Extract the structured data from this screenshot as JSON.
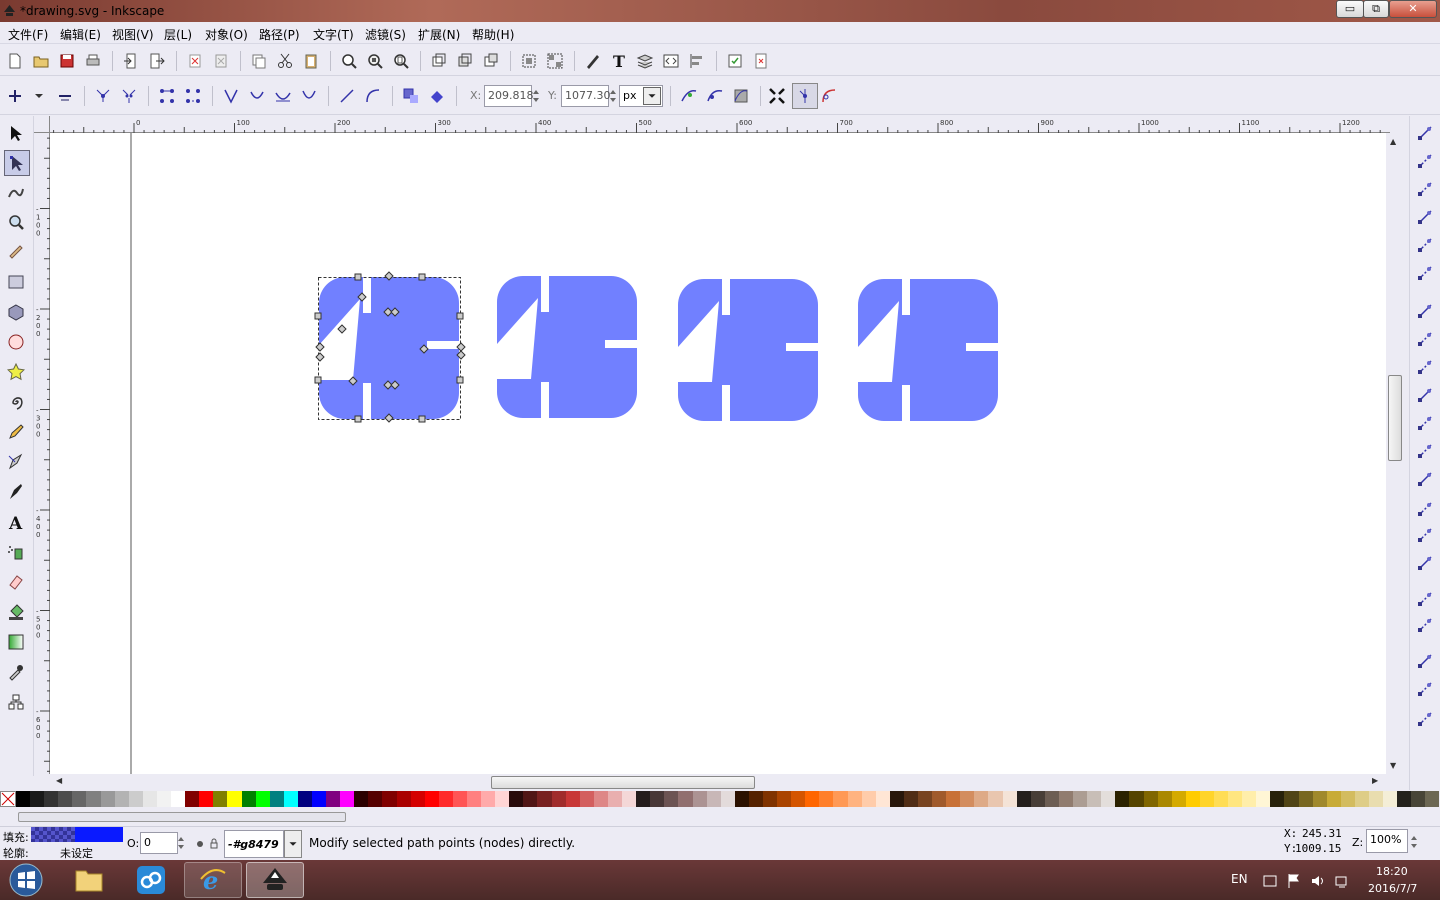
{
  "window": {
    "title": "*drawing.svg - Inkscape",
    "min_label": "▭",
    "max_label": "⧉",
    "close_label": "✕"
  },
  "menu": [
    "文件(F)",
    "编辑(E)",
    "视图(V)",
    "层(L)",
    "对象(O)",
    "路径(P)",
    "文字(T)",
    "滤镜(S)",
    "扩展(N)",
    "帮助(H)"
  ],
  "node_toolbar": {
    "x_label": "X:",
    "x_value": "209.818",
    "y_label": "Y:",
    "y_value": "1077.30",
    "unit": "px"
  },
  "ruler": {
    "h_ticks": [
      "0",
      "100",
      "200",
      "300",
      "400",
      "500",
      "600",
      "700",
      "800",
      "900",
      "1000",
      "1100",
      "1200"
    ],
    "v_ticks": [
      "-100",
      "-200",
      "-300",
      "-400",
      "-500",
      "-600",
      "-700",
      "-800"
    ]
  },
  "shapes": {
    "fill_color": "#7180ff",
    "count": 4
  },
  "status": {
    "fill_label": "填充:",
    "stroke_label": "轮廓:",
    "stroke_value": "未设定",
    "opacity_label": "O:",
    "opacity_value": "0",
    "layer_value": "-#g8479",
    "message": "Modify selected path points (nodes) directly.",
    "cursor_x_label": "X:",
    "cursor_x": "245.31",
    "cursor_y_label": "Y:",
    "cursor_y": "1009.15",
    "zoom_label": "Z:",
    "zoom_value": "100%"
  },
  "taskbar": {
    "lang": "EN",
    "time": "18:20",
    "date": "2016/7/7"
  },
  "colors": {
    "fill_swatch": "#0a1aff",
    "palette": [
      "#000000",
      "#1a1a1a",
      "#333333",
      "#4d4d4d",
      "#666666",
      "#808080",
      "#999999",
      "#b3b3b3",
      "#cccccc",
      "#e6e6e6",
      "#f2f2f2",
      "#ffffff",
      "#800000",
      "#ff0000",
      "#808000",
      "#ffff00",
      "#008000",
      "#00ff00",
      "#008080",
      "#00ffff",
      "#000080",
      "#0000ff",
      "#800080",
      "#ff00ff",
      "#2b0000",
      "#550000",
      "#800000",
      "#aa0000",
      "#d40000",
      "#ff0000",
      "#ff2a2a",
      "#ff5555",
      "#ff8080",
      "#ffaaaa",
      "#ffd5d5",
      "#280b0b",
      "#501616",
      "#782121",
      "#a02c2c",
      "#c83737",
      "#d35f5f",
      "#de8787",
      "#e9afaf",
      "#f4d7d7",
      "#241c1c",
      "#483737",
      "#6c5353",
      "#916f6f",
      "#ac9393",
      "#c8b7b7",
      "#e3dbdb",
      "#2b1100",
      "#552200",
      "#803300",
      "#aa4400",
      "#d45500",
      "#ff6600",
      "#ff7f2a",
      "#ff9955",
      "#ffb380",
      "#ffccaa",
      "#ffe6d5",
      "#28170b",
      "#502d16",
      "#784421",
      "#a05a2c",
      "#c87137",
      "#d38d5f",
      "#deaa87",
      "#e9c6af",
      "#f4e3d7",
      "#241f1c",
      "#483e37",
      "#6c5d53",
      "#917c6f",
      "#ac9d93",
      "#c8beb7",
      "#e3dedb",
      "#2b2200",
      "#554400",
      "#806600",
      "#aa8800",
      "#d4aa00",
      "#ffcc00",
      "#ffd42a",
      "#ffdd55",
      "#ffe680",
      "#ffeeaa",
      "#fff6d5",
      "#28220b",
      "#504416",
      "#786721",
      "#a0892c",
      "#c8ab37",
      "#d3bc5f",
      "#decd87",
      "#e9ddaf",
      "#f4eed7",
      "#24221c",
      "#484537",
      "#6c6753"
    ]
  }
}
